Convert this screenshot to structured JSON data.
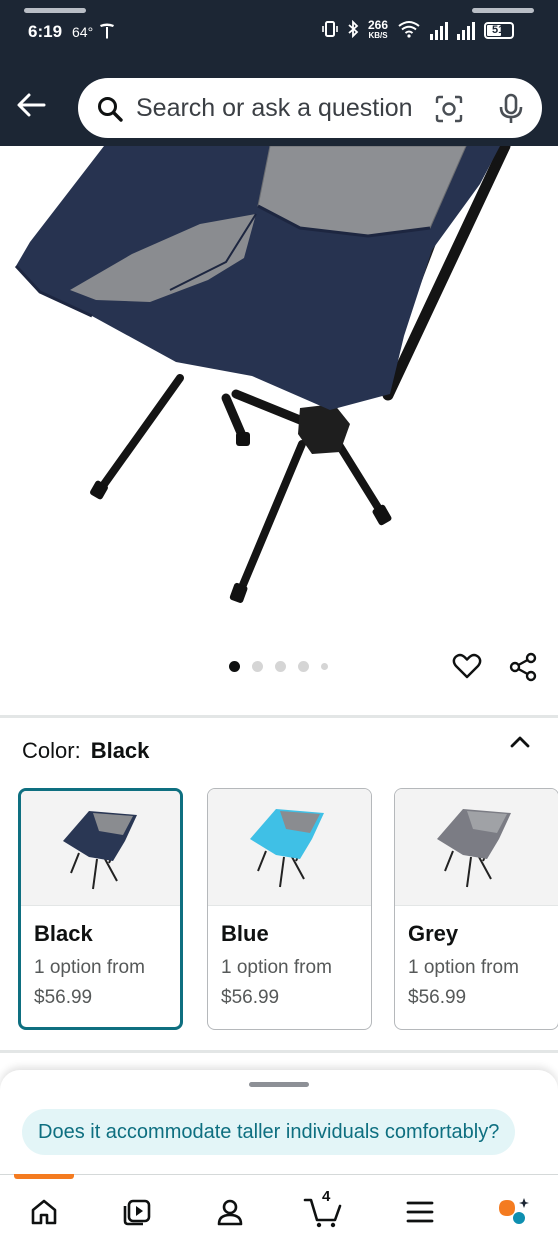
{
  "status_bar": {
    "time": "6:19",
    "temperature": "64°",
    "network_speed_value": "266",
    "network_speed_unit": "KB/S",
    "battery_level": "51"
  },
  "header": {
    "search_placeholder": "Search or ask a question",
    "icons": [
      "back-arrow-icon",
      "search-icon",
      "camera-lens-icon",
      "microphone-icon"
    ]
  },
  "gallery": {
    "image_count": 5,
    "active_index": 0,
    "icons": [
      "heart-icon",
      "share-icon"
    ]
  },
  "color_selector": {
    "label": "Color:",
    "selected_value": "Black",
    "options": [
      {
        "name": "Black",
        "option_text": "1 option from",
        "price": "$56.99",
        "seat_color": "#2a3754",
        "selected": true
      },
      {
        "name": "Blue",
        "option_text": "1 option from",
        "price": "$56.99",
        "seat_color": "#3fc0e6",
        "selected": false
      },
      {
        "name": "Grey",
        "option_text": "1 option from",
        "price": "$56.99",
        "seat_color": "#7b7c84",
        "selected": false
      }
    ]
  },
  "bottom_sheet": {
    "suggestion_chip": "Does it accommodate taller individuals comfortably?"
  },
  "bottom_nav": {
    "items": [
      "home-icon",
      "video-icon",
      "account-icon",
      "cart-icon",
      "menu-icon",
      "rufus-icon"
    ],
    "cart_count": "4",
    "active": "home"
  },
  "colors": {
    "header_bg": "#1c2634",
    "accent_teal": "#0e6f80",
    "chip_bg": "#e3f5f7",
    "nav_indicator": "#f47b20",
    "chair_navy": "#273350"
  }
}
